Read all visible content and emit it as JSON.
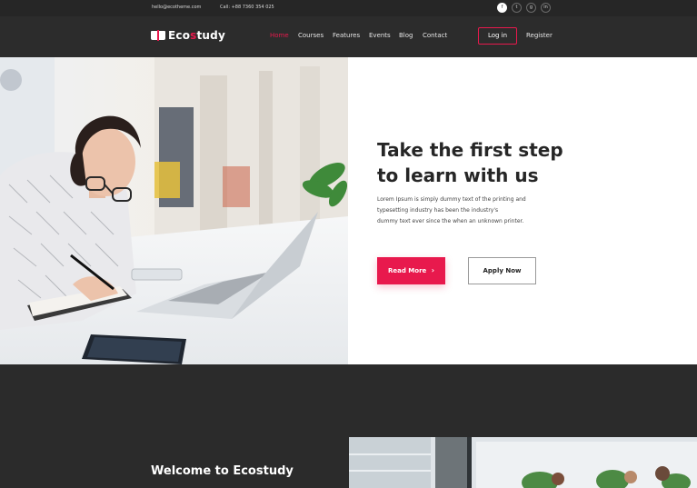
{
  "topbar": {
    "email": "hello@ecotheme.com",
    "phone": "Call: +88 7360 354 025",
    "social": [
      "f",
      "t",
      "g",
      "in"
    ]
  },
  "header": {
    "logo": {
      "prefix": "Eco",
      "accent": "s",
      "suffix": "tudy"
    },
    "nav": [
      "Home",
      "Courses",
      "Features",
      "Events",
      "Blog",
      "Contact"
    ],
    "login": "Log in",
    "register": "Register"
  },
  "hero": {
    "title_line1": "Take the first step",
    "title_line2": "to learn with us",
    "text_line1": "Lorem Ipsum is simply dummy text of the printing and",
    "text_line2": "typesetting industry has been the industry's",
    "text_line3": "dummy text ever since the  when an unknown printer.",
    "read_more": "Read More",
    "apply_now": "Apply Now"
  },
  "welcome": {
    "title": "Welcome to Ecostudy"
  },
  "colors": {
    "accent": "#e8194d",
    "dark": "#2b2b2b",
    "topbar": "#262626"
  }
}
